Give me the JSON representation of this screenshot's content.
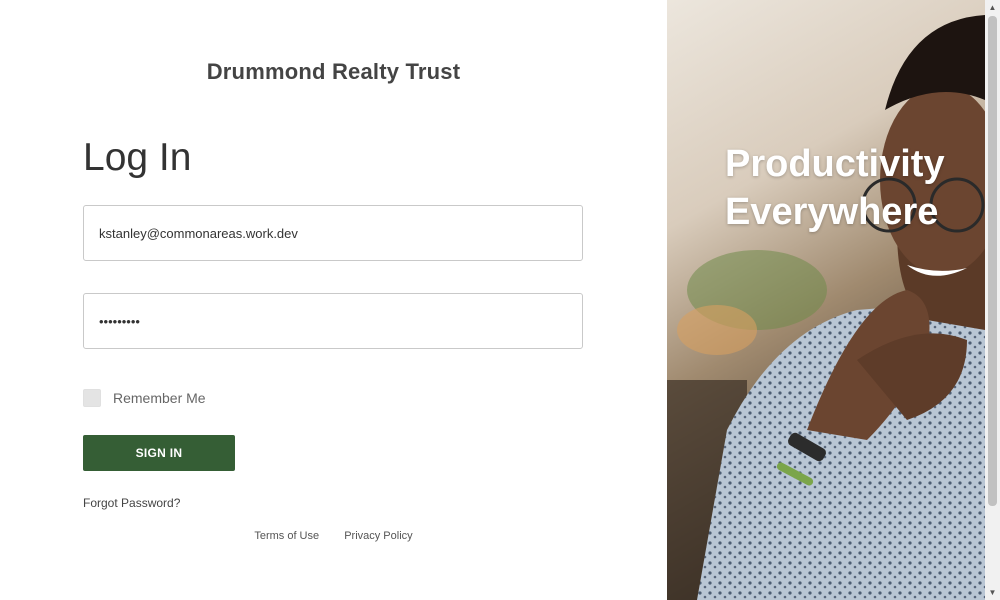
{
  "brand": {
    "name": "Drummond Realty Trust"
  },
  "login": {
    "heading": "Log In",
    "email_value": "kstanley@commonareas.work.dev",
    "password_value": "secretpw1",
    "remember_label": "Remember Me",
    "signin_label": "SIGN IN",
    "forgot_label": "Forgot Password?"
  },
  "footer": {
    "terms_label": "Terms of Use",
    "privacy_label": "Privacy Policy"
  },
  "hero": {
    "line1": "Productivity",
    "line2": "Everywhere"
  },
  "colors": {
    "signin_button": "#355e35",
    "brand_text": "#444444"
  }
}
